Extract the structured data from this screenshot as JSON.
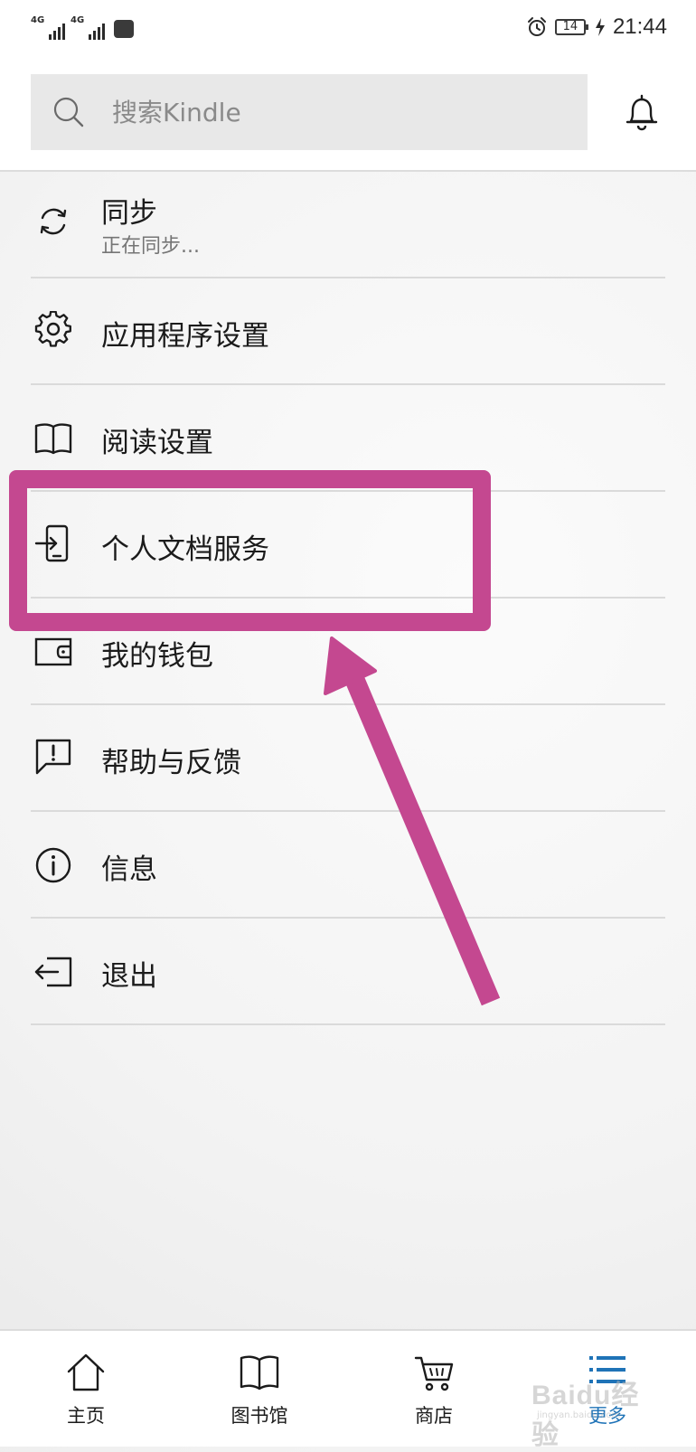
{
  "status_bar": {
    "network_1": "4G",
    "network_2": "4G",
    "battery": "14",
    "time": "21:44"
  },
  "search": {
    "placeholder": "搜索Kindle",
    "value": ""
  },
  "menu": {
    "items": [
      {
        "label": "同步",
        "sublabel": "正在同步...",
        "icon": "sync-icon"
      },
      {
        "label": "应用程序设置",
        "icon": "gear-icon"
      },
      {
        "label": "阅读设置",
        "icon": "open-book-icon"
      },
      {
        "label": "个人文档服务",
        "icon": "document-transfer-icon"
      },
      {
        "label": "我的钱包",
        "icon": "wallet-icon"
      },
      {
        "label": "帮助与反馈",
        "icon": "feedback-icon"
      },
      {
        "label": "信息",
        "icon": "info-icon"
      },
      {
        "label": "退出",
        "icon": "sign-out-icon"
      }
    ]
  },
  "bottom_nav": {
    "items": [
      {
        "label": "主页",
        "icon": "home-icon"
      },
      {
        "label": "图书馆",
        "icon": "library-icon"
      },
      {
        "label": "商店",
        "icon": "cart-icon"
      },
      {
        "label": "更多",
        "icon": "menu-icon",
        "active": true
      }
    ]
  },
  "annotation": {
    "color": "#c44890",
    "highlighted_item": "个人文档服务"
  },
  "watermark": {
    "text": "Baidu经验",
    "sub": "jingyan.baidu.com"
  },
  "colors": {
    "active_tab": "#1f73b7",
    "annotation": "#c44890"
  }
}
